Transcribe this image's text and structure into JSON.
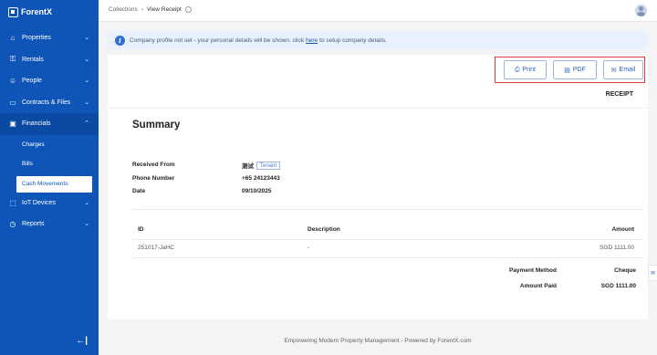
{
  "brand": {
    "name": "ForentX"
  },
  "sidebar": {
    "items": [
      {
        "label": "Properties",
        "icon": "home-icon",
        "glyph": "⌂",
        "chevron": "⌄"
      },
      {
        "label": "Rentals",
        "icon": "key-icon",
        "glyph": "⚿",
        "chevron": "⌄"
      },
      {
        "label": "People",
        "icon": "people-icon",
        "glyph": "☺",
        "chevron": "⌄"
      },
      {
        "label": "Contracts & Files",
        "icon": "folder-icon",
        "glyph": "▭",
        "chevron": "⌄"
      },
      {
        "label": "Financials",
        "icon": "wallet-icon",
        "glyph": "▣",
        "chevron": "⌃"
      },
      {
        "label": "IoT Devices",
        "icon": "device-icon",
        "glyph": "⬚",
        "chevron": "⌄"
      },
      {
        "label": "Reports",
        "icon": "clock-icon",
        "glyph": "◷",
        "chevron": "⌄"
      }
    ],
    "financial_subitems": [
      "Charges",
      "Bills",
      "Cash Movements"
    ],
    "collapse_glyph": "←|"
  },
  "header": {
    "breadcrumb_root": "Collections",
    "breadcrumb_sep": "›",
    "breadcrumb_current": "View Receipt"
  },
  "alert": {
    "text_before": "Company profile not set - your personal details will be shown; click",
    "link": "here",
    "text_after": "to setup company details."
  },
  "actions": {
    "print_label": "Print",
    "pdf_label": "PDF",
    "email_label": "Email",
    "print_glyph": "⎙",
    "pdf_glyph": "▤",
    "email_glyph": "✉"
  },
  "receipt": {
    "heading": "RECEIPT",
    "summary_title": "Summary",
    "received_from_label": "Received From",
    "received_from_value": "测试",
    "received_from_tag": "Tenant",
    "phone_label": "Phone Number",
    "phone_value": "+65 24123443",
    "date_label": "Date",
    "date_value": "09/10/2025"
  },
  "table": {
    "headers": {
      "id": "ID",
      "description": "Description",
      "amount": "Amount"
    },
    "rows": [
      {
        "id": "251017-JaHC",
        "description": "-",
        "amount": "SGD 1111.00"
      }
    ]
  },
  "totals": {
    "payment_method_label": "Payment Method",
    "payment_method_value": "Cheque",
    "amount_paid_label": "Amount Paid",
    "amount_paid_value": "SGD 1111.00"
  },
  "footer": {
    "text": "Empowering Modern Property Management - Powered by ForentX.com"
  },
  "colors": {
    "sidebar": "#0f55b8",
    "accent": "#2d63b8",
    "highlight": "#e23c3c"
  }
}
